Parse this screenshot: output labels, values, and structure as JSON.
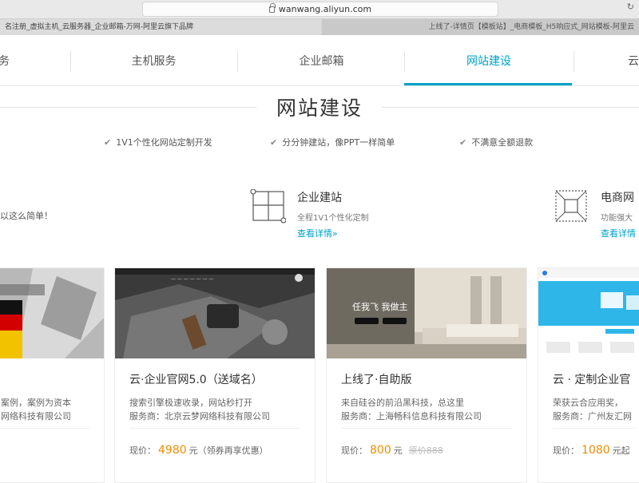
{
  "browser": {
    "url": "wanwang.aliyun.com",
    "tab1_title": "名注册_虚拟主机_云服务器_企业邮箱-万网-阿里云旗下品牌",
    "tab2_title": "上线了-详情页【模板站】_电商模板_H5响应式_网站模板-阿里云"
  },
  "nav": {
    "items": [
      {
        "label": "务"
      },
      {
        "label": "主机服务"
      },
      {
        "label": "企业邮箱"
      },
      {
        "label": "网站建设"
      },
      {
        "label": "云"
      }
    ],
    "active_color": "#00a2ca"
  },
  "section": {
    "title": "网站建设",
    "features": [
      "1V1个性化网站定制开发",
      "分分钟建站，像PPT一样简单",
      "不满意全额退款"
    ]
  },
  "services": {
    "left_partial_desc": "以这么简单！",
    "enterprise": {
      "title": "企业建站",
      "subtitle": "全程1V1个性化定制",
      "link": "查看详情»"
    },
    "ecommerce": {
      "title": "电商网",
      "subtitle": "功能强大",
      "link": "查看详情"
    }
  },
  "cards": [
    {
      "title": "",
      "desc1": "案例，案例为资本",
      "desc2": "网络科技有限公司",
      "price_label": "",
      "price": "",
      "unit": "",
      "note": "",
      "original": ""
    },
    {
      "title": "云·企业官网5.0（送域名）",
      "desc1": "搜索引擎极速收录，网站秒打开",
      "desc2": "服务商：北京云梦网络科技有限公司",
      "price_label": "现价：",
      "price": "4980",
      "unit": "元",
      "note": "（领券再享优惠）",
      "original": ""
    },
    {
      "title": "上线了·自助版",
      "desc1": "来自硅谷的前沿黑科技，总这里",
      "desc2": "服务商：上海畅科信息科技有限公司",
      "price_label": "现价：",
      "price": "800",
      "unit": "元",
      "note": "",
      "original": "原价888"
    },
    {
      "title": "云 · 定制企业官",
      "desc1": "荣获云合应用奖，",
      "desc2": "服务商：广州友汇网",
      "price_label": "现价：",
      "price": "1080",
      "unit": "元起",
      "note": "",
      "original": ""
    }
  ],
  "card_images": {
    "card3_overlay_text": "任我飞 我做主"
  }
}
